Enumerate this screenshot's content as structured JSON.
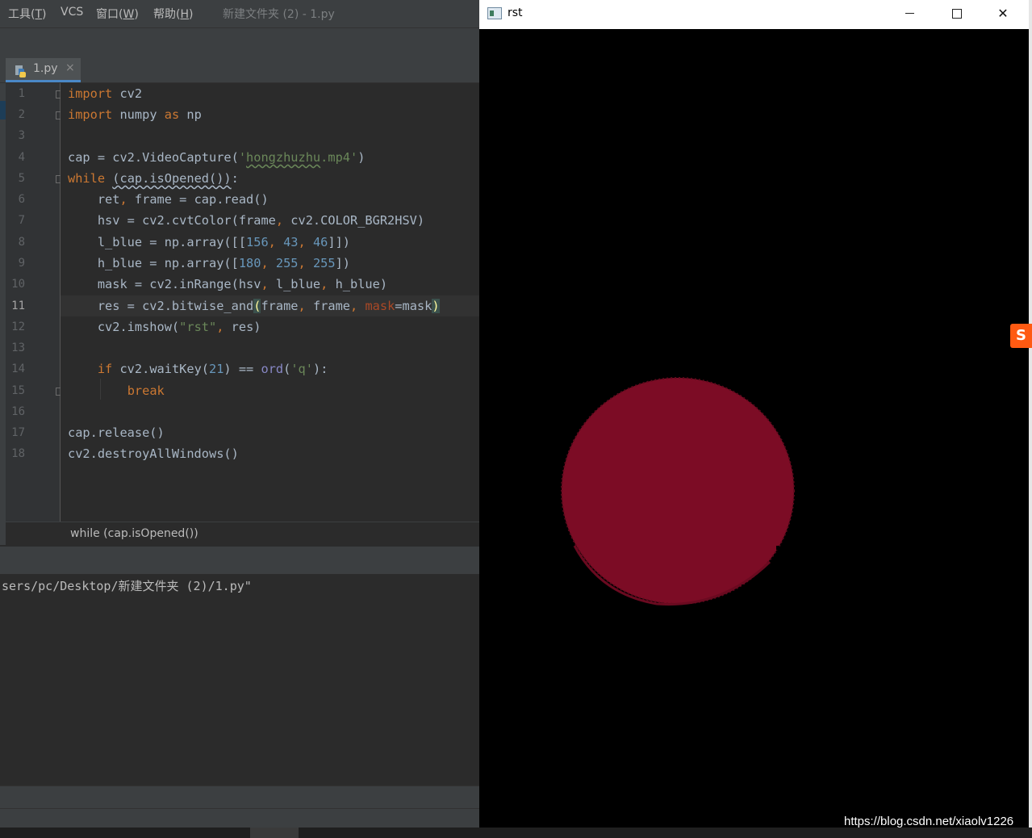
{
  "ide": {
    "menu": [
      {
        "label": "工具(",
        "mnemonic": "T",
        "suffix": ")"
      },
      {
        "label": "VCS"
      },
      {
        "label": "窗口(",
        "mnemonic": "W",
        "suffix": ")"
      },
      {
        "label": "帮助(",
        "mnemonic": "H",
        "suffix": ")"
      }
    ],
    "window_title": "新建文件夹 (2) - 1.py",
    "tab": {
      "label": "1.py",
      "close": "×"
    },
    "line_numbers": [
      "1",
      "2",
      "3",
      "4",
      "5",
      "6",
      "7",
      "8",
      "9",
      "10",
      "11",
      "12",
      "13",
      "14",
      "15",
      "16",
      "17",
      "18"
    ],
    "current_line": "11",
    "breadcrumb": "while (cap.isOpened())",
    "console_output": "sers/pc/Desktop/新建文件夹 (2)/1.py\"",
    "code": {
      "l1": {
        "kw": "import",
        "rest": " cv2"
      },
      "l2": {
        "kw1": "import",
        "mid": " numpy ",
        "kw2": "as",
        "rest": " np"
      },
      "l4": {
        "pre": "cap = cv2.VideoCapture(",
        "q1": "'",
        "fname": "hongzhuzhu",
        "ext": ".mp4'",
        "post": ")"
      },
      "l5": {
        "kw": "while",
        "sp": " ",
        "cond": "(cap.isOpened())",
        "colon": ":"
      },
      "l6": {
        "a": "    ret",
        "comma": ",",
        "b": " frame = cap.read()"
      },
      "l7": {
        "a": "    hsv = cv2.cvtColor(frame",
        "comma": ",",
        "b": " cv2.COLOR_BGR2HSV)"
      },
      "l8": {
        "a": "    l_blue = np.array([[",
        "n1": "156",
        "c1": ", ",
        "n2": "43",
        "c2": ", ",
        "n3": "46",
        "b": "]])"
      },
      "l9": {
        "a": "    h_blue = np.array([",
        "n1": "180",
        "c1": ", ",
        "n2": "255",
        "c2": ", ",
        "n3": "255",
        "b": "])"
      },
      "l10": {
        "a": "    mask = cv2.inRange(hsv",
        "c1": ",",
        "b": " l_blue",
        "c2": ",",
        "c": " h_blue)"
      },
      "l11": {
        "a": "    res = cv2.bitwise_and",
        "open": "(",
        "b": "frame",
        "c1": ",",
        "c": " frame",
        "c2": ", ",
        "param": "mask",
        "d": "=mask",
        "close": ")"
      },
      "l12": {
        "a": "    cv2.imshow(",
        "s": "\"rst\"",
        "c1": ",",
        "b": " res)"
      },
      "l14": {
        "ind": "    ",
        "kw": "if",
        "a": " cv2.waitKey(",
        "n": "21",
        "b": ") == ",
        "ord": "ord",
        "c": "(",
        "s": "'q'",
        "d": "):"
      },
      "l15": {
        "ind": "        ",
        "kw": "break"
      },
      "l17": {
        "a": "cap.release()"
      },
      "l18": {
        "a": "cv2.destroyAllWindows()"
      }
    }
  },
  "rst_window": {
    "title": "rst",
    "min_label": "",
    "max_label": "",
    "close_label": "✕"
  },
  "overlay": {
    "sougou_label": "S",
    "watermark": "https://blog.csdn.net/xiaolv1226"
  },
  "colors": {
    "ide_background": "#2b2b2b",
    "keyword": "#cc7832",
    "string": "#6a8759",
    "number": "#6897bb",
    "masked_object": "#7c0c25"
  }
}
